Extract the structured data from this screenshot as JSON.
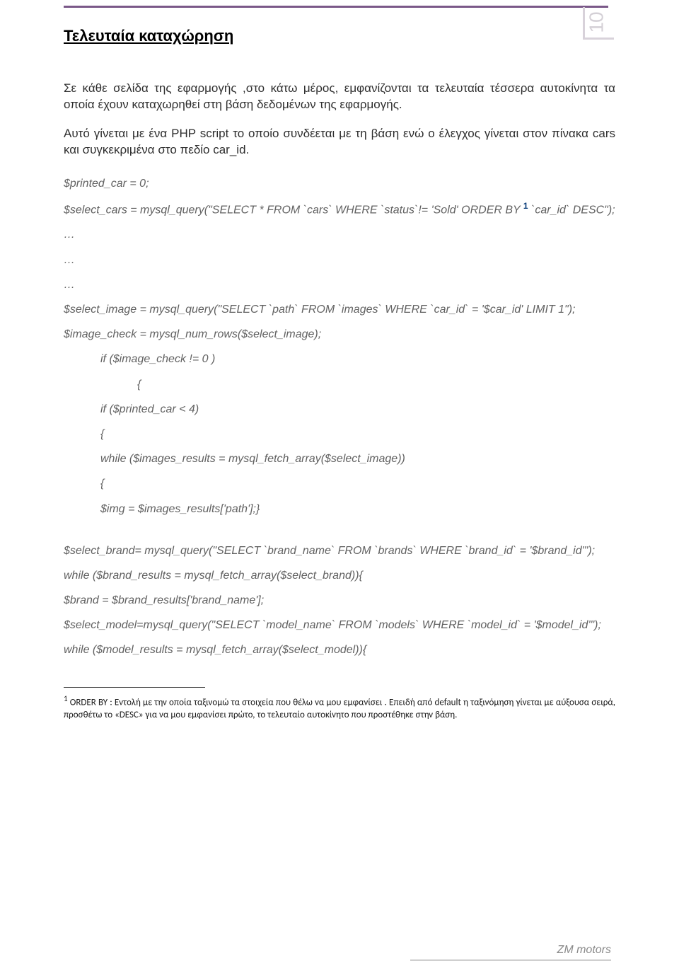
{
  "pageNumber": "10",
  "heading": "Τελευταία καταχώρηση",
  "para1": "Σε κάθε σελίδα της εφαρμογής ,στο κάτω μέρος, εμφανίζονται τα τελευταία τέσσερα αυτοκίνητα τα οποία έχουν καταχωρηθεί στη βάση δεδομένων της εφαρμογής.",
  "para2": "Αυτό γίνεται με ένα PHP script το οποίο συνδέεται με τη βάση ενώ ο έλεγχος γίνεται στον πίνακα cars και συγκεκριμένα στο πεδίο car_id.",
  "code": {
    "l1": "$printed_car = 0;",
    "l2a": "$select_cars = mysql_query(\"SELECT * FROM `cars` WHERE `status`!= 'Sold' ORDER BY",
    "l2sup": "1",
    "l2b": "`car_id` DESC\");",
    "dots": "…",
    "l3": "$select_image = mysql_query(\"SELECT `path` FROM `images` WHERE `car_id` = '$car_id' LIMIT 1\");",
    "l4": "$image_check = mysql_num_rows($select_image);",
    "l5": "if ($image_check != 0 )",
    "l6": "{",
    "l7": "if ($printed_car < 4)",
    "l8": "{",
    "l9": "while ($images_results = mysql_fetch_array($select_image))",
    "l10": "{",
    "l11": "$img = $images_results['path'];}",
    "l12": "$select_brand= mysql_query(\"SELECT `brand_name` FROM `brands` WHERE `brand_id` = '$brand_id'\");",
    "l13": "while ($brand_results = mysql_fetch_array($select_brand)){",
    "l14": "$brand = $brand_results['brand_name'];",
    "l15": "$select_model=mysql_query(\"SELECT `model_name` FROM `models` WHERE `model_id` = '$model_id'\");",
    "l16": "while ($model_results = mysql_fetch_array($select_model)){"
  },
  "footnote": {
    "sup": "1",
    "text": " ORDER BY : Εντολή με την οποία ταξινομώ τα στοιχεία που θέλω να μου εμφανίσει . Επειδή από default η ταξινόμηση γίνεται με αύξουσα σειρά, προσθέτω το «DESC» για να μου εμφανίσει πρώτο, το τελευταίο αυτοκίνητο που προστέθηκε στην βάση."
  },
  "footerBrand": "ZM motors"
}
